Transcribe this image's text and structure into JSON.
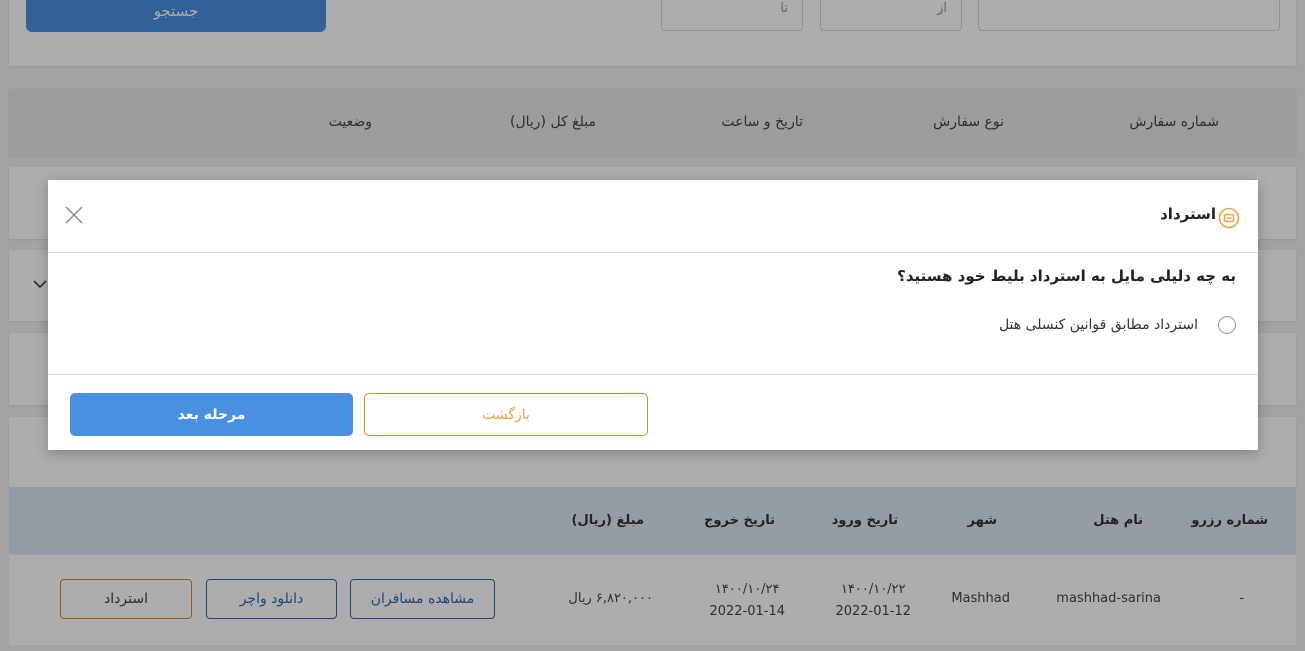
{
  "search": {
    "button_label": "جستجو",
    "to_placeholder": "تا",
    "from_placeholder": "از",
    "order_placeholder": ""
  },
  "orders_table": {
    "headers": {
      "order_number": "شماره سفارش",
      "order_type": "نوع سفارش",
      "date_time": "تاریخ و ساعت",
      "total_amount": "مبلغ کل (ریال)",
      "status": "وضعیت"
    }
  },
  "hotel_table": {
    "headers": {
      "reserve_number": "شماره رزرو",
      "hotel_name": "نام هتل",
      "city": "شهر",
      "checkin_date": "تاریخ ورود",
      "checkout_date": "تاریخ خروج",
      "amount": "مبلغ (ریال)"
    },
    "row": {
      "reserve_number": "-",
      "hotel_name": "mashhad-sarina",
      "city": "Mashhad",
      "checkin_jalali": "۱۴۰۰/۱۰/۲۲",
      "checkin_gregorian": "2022-01-12",
      "checkout_jalali": "۱۴۰۰/۱۰/۲۴",
      "checkout_gregorian": "2022-01-14",
      "amount": "۶,۸۲۰,۰۰۰ ریال",
      "view_passengers_label": "مشاهده مسافران",
      "download_voucher_label": "دانلود واچر",
      "refund_label": "استرداد"
    }
  },
  "modal": {
    "title": "استرداد",
    "question": "به چه دلیلی مایل به استرداد بلیط خود هستید؟",
    "option_label": "استرداد مطابق قوانین کنسلی هتل",
    "next_label": "مرحله بعد",
    "back_label": "بازگشت"
  },
  "colors": {
    "primary_blue": "#4a90e2",
    "accent_orange": "#e8a33d"
  }
}
